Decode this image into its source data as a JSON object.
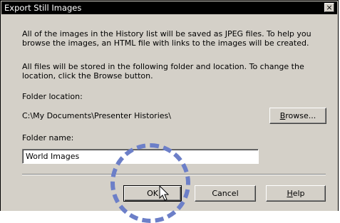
{
  "dialog": {
    "title": "Export Still Images",
    "close_label": "×",
    "description_1": "All of the images in the History list will be saved as JPEG files. To help you browse the images, an HTML file with links to the images will be created.",
    "description_2": "All files will be stored in the following folder and location. To change the location, click the Browse button.",
    "folder_location_label": "Folder location:",
    "folder_location_value": "C:\\My Documents\\Presenter Histories\\",
    "browse_prefix": "B",
    "browse_rest": "rowse...",
    "folder_name_label": "Folder name:",
    "folder_name_value": "World Images",
    "ok_label": "OK",
    "cancel_label": "Cancel",
    "help_prefix": "H",
    "help_rest": "elp"
  },
  "annotation": {
    "color": "#6c7fc8"
  }
}
